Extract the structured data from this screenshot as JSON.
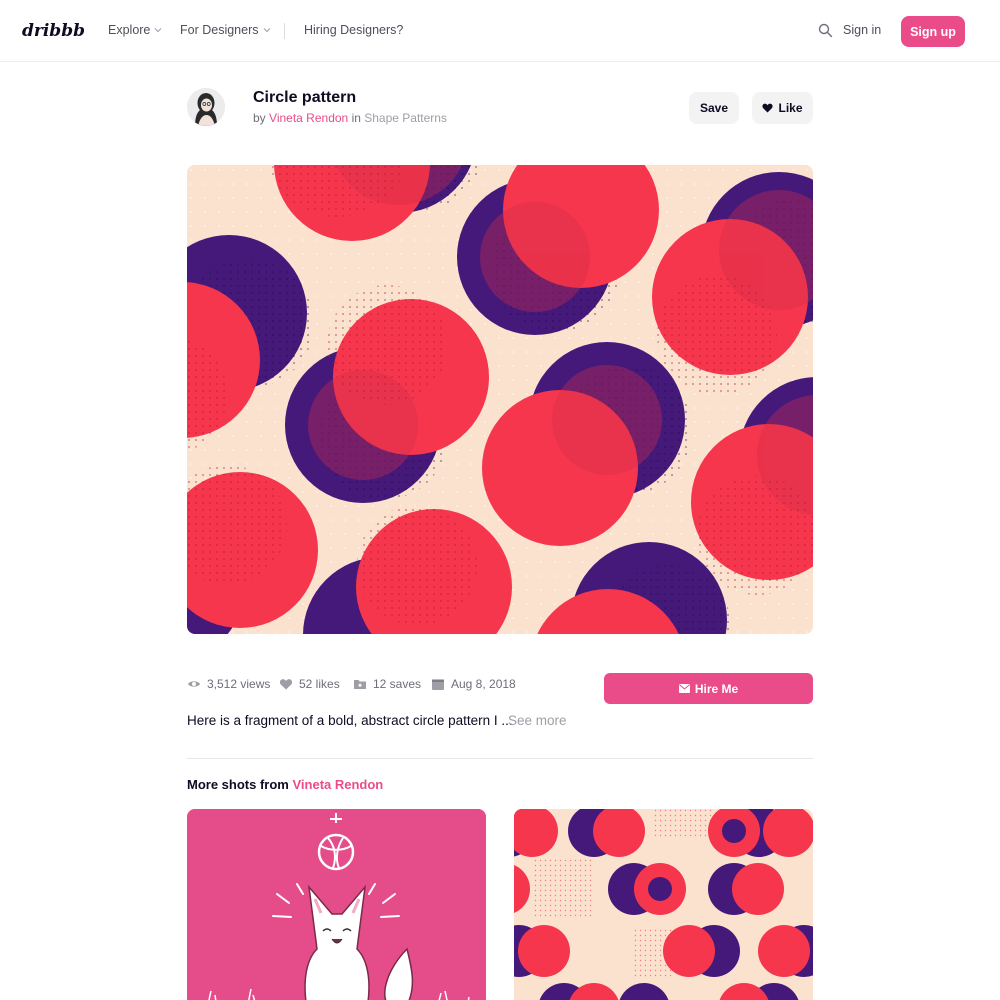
{
  "header": {
    "logo_text": "dribbble",
    "nav": [
      {
        "label": "Explore"
      },
      {
        "label": "For Designers"
      },
      {
        "label": "Hiring Designers?"
      }
    ],
    "sign_in": "Sign in",
    "sign_up": "Sign up",
    "icons": {
      "search": "search-icon",
      "chevron": "chevron-down-icon"
    }
  },
  "shot": {
    "title": "Circle pattern",
    "by_prefix": "by",
    "author": "Vineta Rendon",
    "in_word": "in",
    "category": "Shape Patterns",
    "save_label": "Save",
    "like_label": "Like",
    "image_name": "circle-pattern-artwork"
  },
  "stats": {
    "views": "3,512 views",
    "likes": "52 likes",
    "saves": "12 saves",
    "date": "Aug 8, 2018"
  },
  "hire_label": "Hire Me",
  "description": "Here is a fragment of a bold, abstract circle pattern I ...",
  "see_more": "See more",
  "more_shots": {
    "heading_prefix": "More shots from",
    "author": "Vineta Rendon"
  },
  "colors": {
    "brand_pink": "#ea4c89",
    "coral": "#f5364d",
    "purple": "#45197a",
    "peach": "#fbe2cf",
    "text_dark": "#0d0c22",
    "text_muted": "#6e6d7a"
  }
}
